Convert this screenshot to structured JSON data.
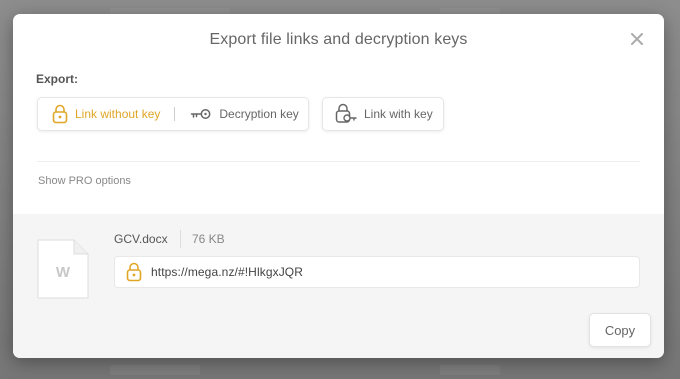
{
  "dialog": {
    "title": "Export file links and decryption keys",
    "close_icon": "close-icon"
  },
  "export": {
    "label": "Export:",
    "options": [
      {
        "label": "Link without key",
        "icon": "lock-icon",
        "active": true
      },
      {
        "label": "Decryption key",
        "icon": "key-icon",
        "active": false
      },
      {
        "label": "Link with key",
        "icon": "lock-with-key-icon",
        "active": false
      }
    ],
    "pro_options_label": "Show PRO options"
  },
  "file": {
    "name": "GCV.docx",
    "size": "76 KB",
    "type_letter": "W",
    "link": "https://mega.nz/#!HlkgxJQR"
  },
  "actions": {
    "copy_label": "Copy"
  },
  "colors": {
    "accent": "#e0a626",
    "text": "#666666",
    "section_bg": "#f5f5f5"
  }
}
